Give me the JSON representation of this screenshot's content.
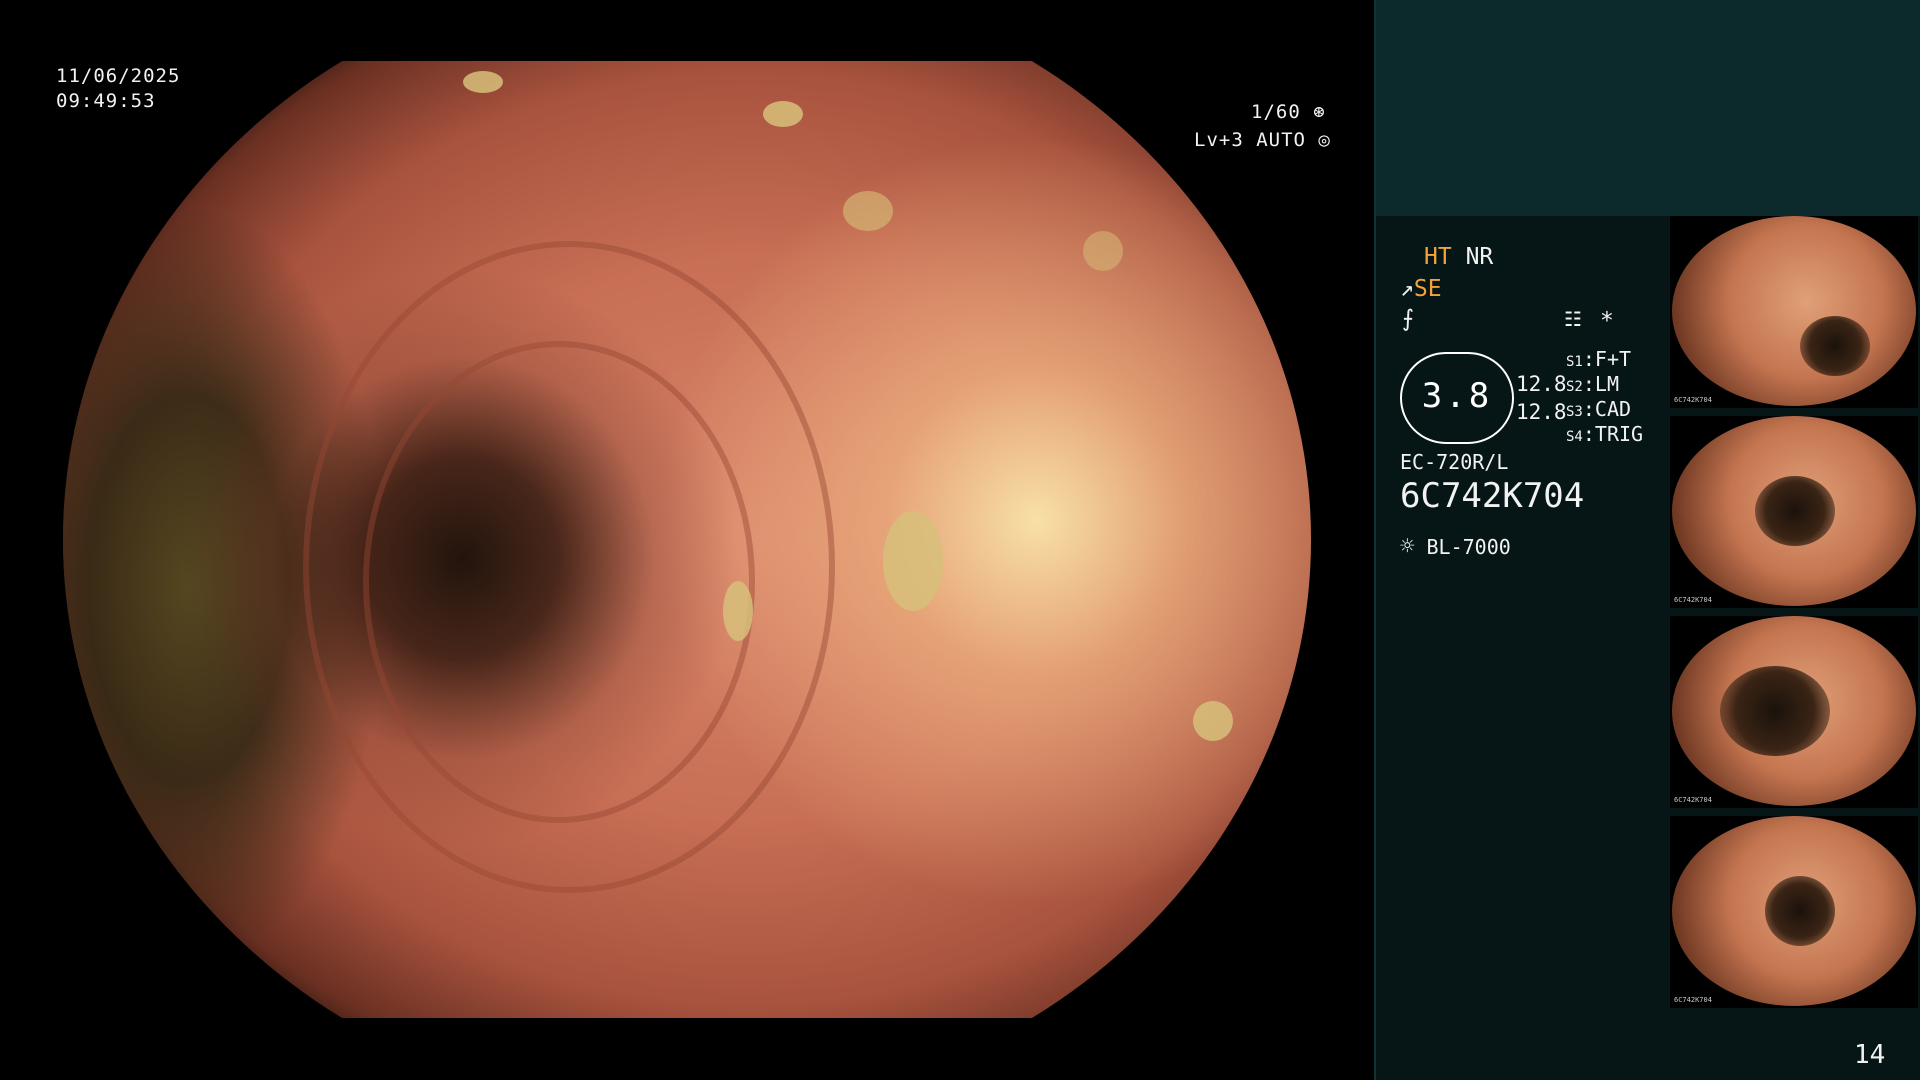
{
  "overlay": {
    "date": "11/06/2025",
    "time": "09:49:53",
    "shutter": "1/60",
    "level": "Lv+3 AUTO"
  },
  "panel": {
    "ht": "HT",
    "nr": "NR",
    "se": "SE",
    "gauge_value": "3.8",
    "values": [
      "12.8",
      "12.8"
    ],
    "modes": [
      {
        "key": "S1",
        "label": "F+T"
      },
      {
        "key": "S2",
        "label": "LM"
      },
      {
        "key": "S3",
        "label": "CAD"
      },
      {
        "key": "S4",
        "label": "TRIG"
      }
    ],
    "asterisk": "*",
    "scope_model": "EC-720R/L",
    "serial": "6C742K704",
    "light_source": "BL-7000",
    "image_count": "14"
  },
  "thumbnails": [
    {
      "serial": "6C742K704",
      "index": "13"
    },
    {
      "serial": "6C742K704",
      "index": "12"
    },
    {
      "serial": "6C742K704",
      "index": "11"
    },
    {
      "serial": "6C742K704",
      "index": "10"
    }
  ],
  "colors": {
    "accent_orange": "#f2a33a",
    "panel_top": "#0c2a2c",
    "panel_bottom": "#061617"
  },
  "icons": [
    "shutter-icon",
    "auto-iris-icon",
    "scope-angle-icon",
    "freeze-icon",
    "settings-list-icon",
    "light-icon"
  ]
}
